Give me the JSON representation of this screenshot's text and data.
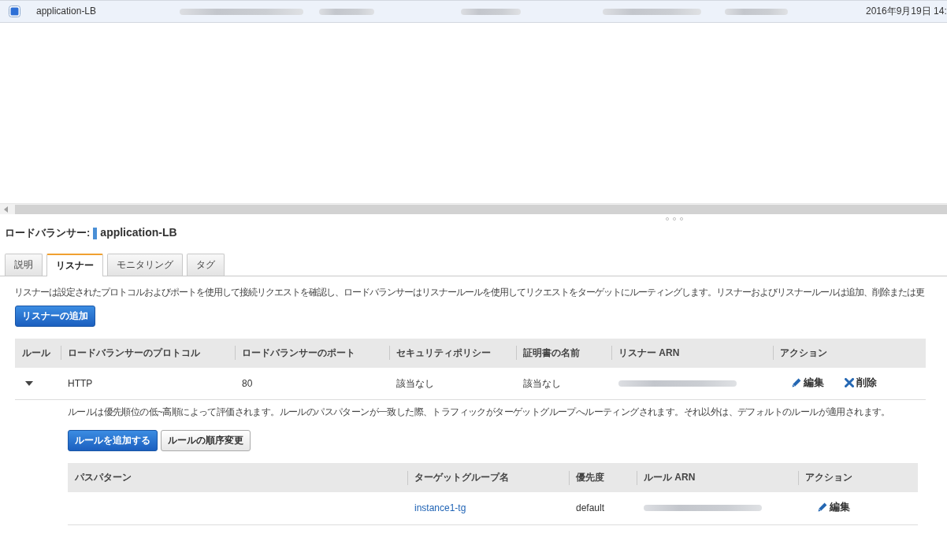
{
  "resource_row": {
    "selected": true,
    "cells": [
      {
        "kind": "text",
        "text": "application-LB"
      },
      {
        "kind": "redacted"
      },
      {
        "kind": "redacted"
      },
      {
        "kind": "redacted"
      },
      {
        "kind": "redacted"
      },
      {
        "kind": "redacted"
      },
      {
        "kind": "text",
        "text": "2016年9月19日 14:"
      }
    ]
  },
  "details": {
    "label": "ロードバランサー:",
    "name": "application-LB",
    "tabs": [
      {
        "label": "説明",
        "selected": false
      },
      {
        "label": "リスナー",
        "selected": true
      },
      {
        "label": "モニタリング",
        "selected": false
      },
      {
        "label": "タグ",
        "selected": false
      }
    ],
    "description": "リスナーは設定されたプロトコルおよびポートを使用して接続リクエストを確認し、ロードバランサーはリスナールールを使用してリクエストをターゲットにルーティングします。リスナーおよびリスナールールは追加、削除または更",
    "add_button": "リスナーの追加",
    "listener_table": {
      "columns": [
        "ルール",
        "ロードバランサーのプロトコル",
        "ロードバランサーのポート",
        "セキュリティポリシー",
        "証明書の名前",
        "リスナー ARN",
        "アクション"
      ],
      "rows": [
        {
          "expanded": true,
          "cells": [
            {
              "kind": "expander"
            },
            {
              "kind": "text",
              "text": "HTTP"
            },
            {
              "kind": "text",
              "text": "80"
            },
            {
              "kind": "text",
              "text": "該当なし"
            },
            {
              "kind": "text",
              "text": "該当なし"
            },
            {
              "kind": "redacted"
            },
            {
              "kind": "actions",
              "actions": [
                {
                  "kind": "edit",
                  "label": "編集"
                },
                {
                  "kind": "delete",
                  "label": "削除"
                }
              ]
            }
          ],
          "rules": {
            "description": "ルールは優先順位の低~高順によって評価されます。ルールのパスパターンが一致した際、トラフィックがターゲットグループへルーティングされます。それ以外は、デフォルトのルールが適用されます。",
            "buttons": [
              {
                "kind": "primary",
                "label": "ルールを追加する"
              },
              {
                "kind": "secondary",
                "label": "ルールの順序変更"
              }
            ],
            "table": {
              "columns": [
                "パスパターン",
                "ターゲットグループ名",
                "優先度",
                "ルール ARN",
                "アクション"
              ],
              "rows": [
                {
                  "cells": [
                    {
                      "kind": "empty"
                    },
                    {
                      "kind": "link",
                      "text": "instance1-tg"
                    },
                    {
                      "kind": "text",
                      "text": "default"
                    },
                    {
                      "kind": "redacted"
                    },
                    {
                      "kind": "actions",
                      "actions": [
                        {
                          "kind": "edit",
                          "label": "編集"
                        }
                      ]
                    }
                  ]
                }
              ]
            }
          }
        }
      ]
    }
  }
}
